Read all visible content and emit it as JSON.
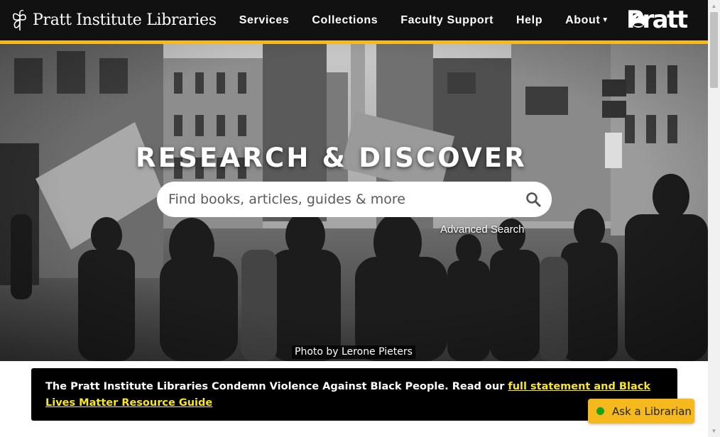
{
  "header": {
    "site_name": "Pratt Institute Libraries",
    "nav": [
      {
        "label": "Services"
      },
      {
        "label": "Collections"
      },
      {
        "label": "Faculty Support"
      },
      {
        "label": "Help"
      },
      {
        "label": "About",
        "has_dropdown": true
      }
    ],
    "brand_logo_text": "Pratt",
    "user_icon": "user-circle-icon",
    "accent_color": "#f8b816"
  },
  "hero": {
    "title": "RESEARCH & DISCOVER",
    "search": {
      "placeholder": "Find books, articles, guides & more",
      "value": ""
    },
    "advanced_search_label": "Advanced Search",
    "photo_credit": "Photo by Lerone Pieters"
  },
  "notice": {
    "text": "The Pratt Institute Libraries Condemn Violence Against Black People. Read our ",
    "link_text": "full statement and Black Lives Matter Resource Guide",
    "link_color": "#f8e71c"
  },
  "chat": {
    "label": "Ask a Librarian",
    "status_color": "#1aa01a",
    "background": "#f5b91e"
  }
}
